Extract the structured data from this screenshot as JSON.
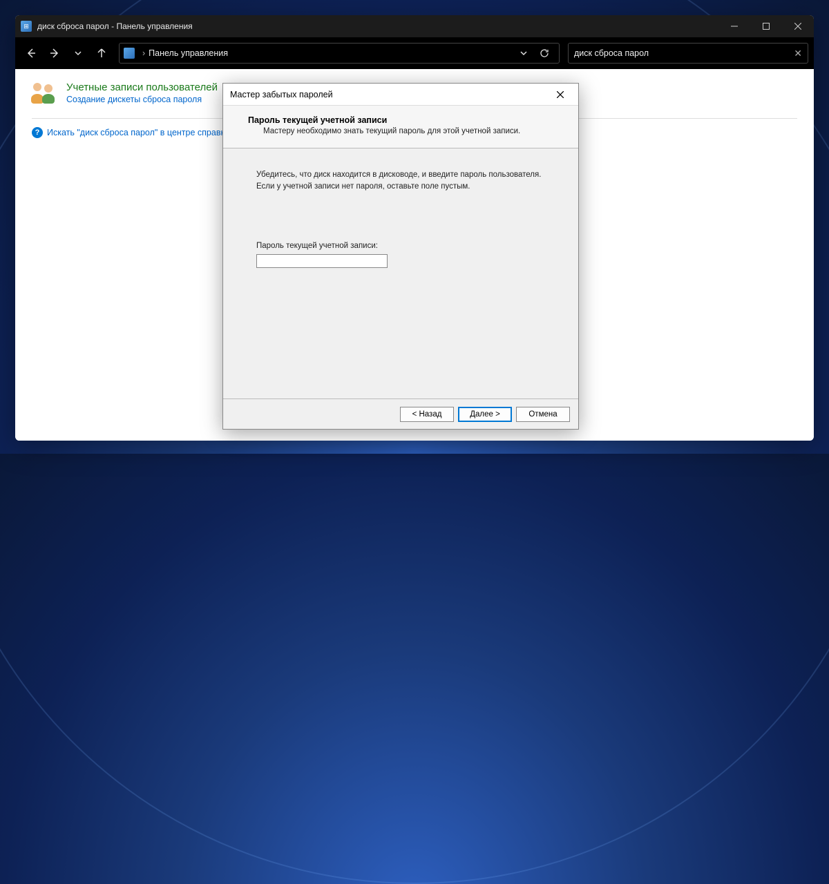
{
  "window": {
    "title": "диск сброса парол - Панель управления"
  },
  "toolbar": {
    "address_label": "Панель управления",
    "search_value": "диск сброса парол"
  },
  "content": {
    "category_title": "Учетные записи пользователей",
    "category_link": "Создание дискеты сброса пароля",
    "help_link": "Искать \"диск сброса парол\" в центре справки и по"
  },
  "wizard": {
    "title": "Мастер забытых паролей",
    "header_title": "Пароль текущей учетной записи",
    "header_sub": "Мастеру необходимо знать текущий пароль для этой учетной записи.",
    "hint": "Убедитесь, что диск находится в дисководе, и введите пароль пользователя. Если у учетной записи нет пароля, оставьте поле пустым.",
    "field_label": "Пароль текущей учетной записи:",
    "field_value": "",
    "btn_back": "< Назад",
    "btn_next": "Далее >",
    "btn_cancel": "Отмена"
  }
}
